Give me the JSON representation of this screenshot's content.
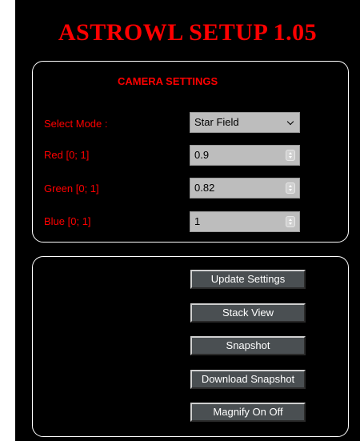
{
  "app": {
    "title": "ASTROWL SETUP 1.05"
  },
  "camera_settings": {
    "title": "CAMERA SETTINGS",
    "mode": {
      "label": "Select Mode :",
      "value": "Star Field"
    },
    "red": {
      "label": "Red [0; 1]",
      "value": "0.9"
    },
    "green": {
      "label": "Green [0; 1]",
      "value": "0.82"
    },
    "blue": {
      "label": "Blue [0; 1]",
      "value": "1"
    }
  },
  "actions": {
    "update_settings": "Update Settings",
    "stack_view": "Stack View",
    "snapshot": "Snapshot",
    "download_snapshot": "Download Snapshot",
    "magnify": "Magnify On Off"
  },
  "colors": {
    "accent": "#ff0000",
    "background": "#000000",
    "input_bg": "#bdbdbd",
    "button_bg": "#4a4f52"
  },
  "icons": {
    "select": "chevron-down-icon",
    "number_input": "spinner-icon"
  }
}
